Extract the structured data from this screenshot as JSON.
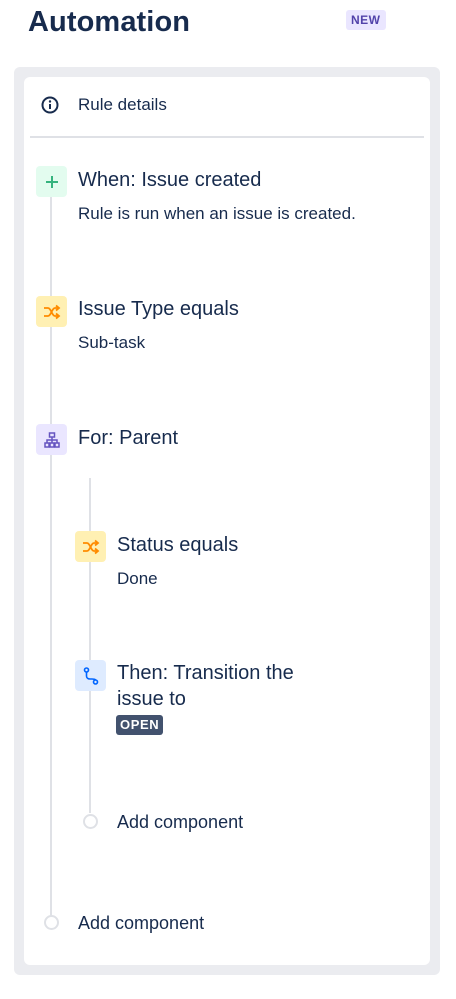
{
  "page": {
    "title": "Automation",
    "badge": "NEW"
  },
  "rule_details": {
    "label": "Rule details",
    "icon": "info-icon"
  },
  "steps": [
    {
      "type": "trigger",
      "icon": "plus-icon",
      "title": "When: Issue created",
      "subtitle": "Rule is run when an issue is created.",
      "color": "#36b37e"
    },
    {
      "type": "condition",
      "icon": "shuffle-icon",
      "title": "Issue Type equals",
      "subtitle": "Sub-task",
      "color": "#ff8b00"
    },
    {
      "type": "branch",
      "icon": "hierarchy-icon",
      "title": "For: Parent",
      "color": "#6554c0"
    }
  ],
  "branch_steps": [
    {
      "type": "condition",
      "icon": "shuffle-icon",
      "title": "Status equals",
      "subtitle": "Done",
      "color": "#ff8b00"
    },
    {
      "type": "action",
      "icon": "transition-icon",
      "title_line1": "Then: Transition the",
      "title_line2": "issue to",
      "lozenge": "OPEN",
      "color": "#0065ff"
    }
  ],
  "add_component_branch": "Add component",
  "add_component_main": "Add component"
}
